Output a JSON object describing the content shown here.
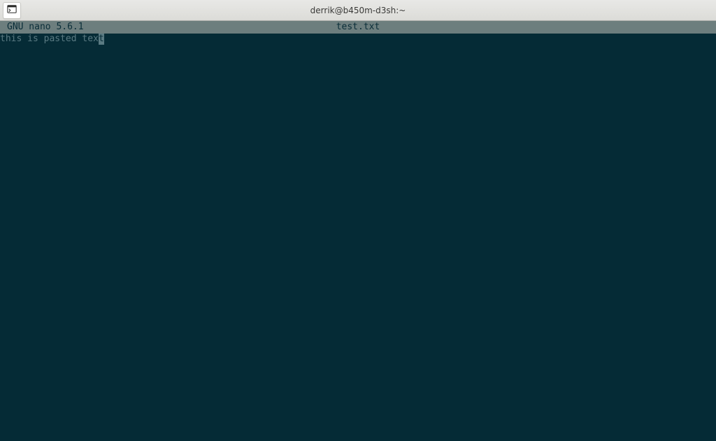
{
  "titlebar": {
    "title": "derrik@b450m-d3sh:~"
  },
  "nano": {
    "header_left": "GNU nano 5.6.1",
    "header_filename": "test.txt"
  },
  "editor": {
    "content_before_cursor": "this is pasted tex",
    "cursor_char": "t"
  }
}
